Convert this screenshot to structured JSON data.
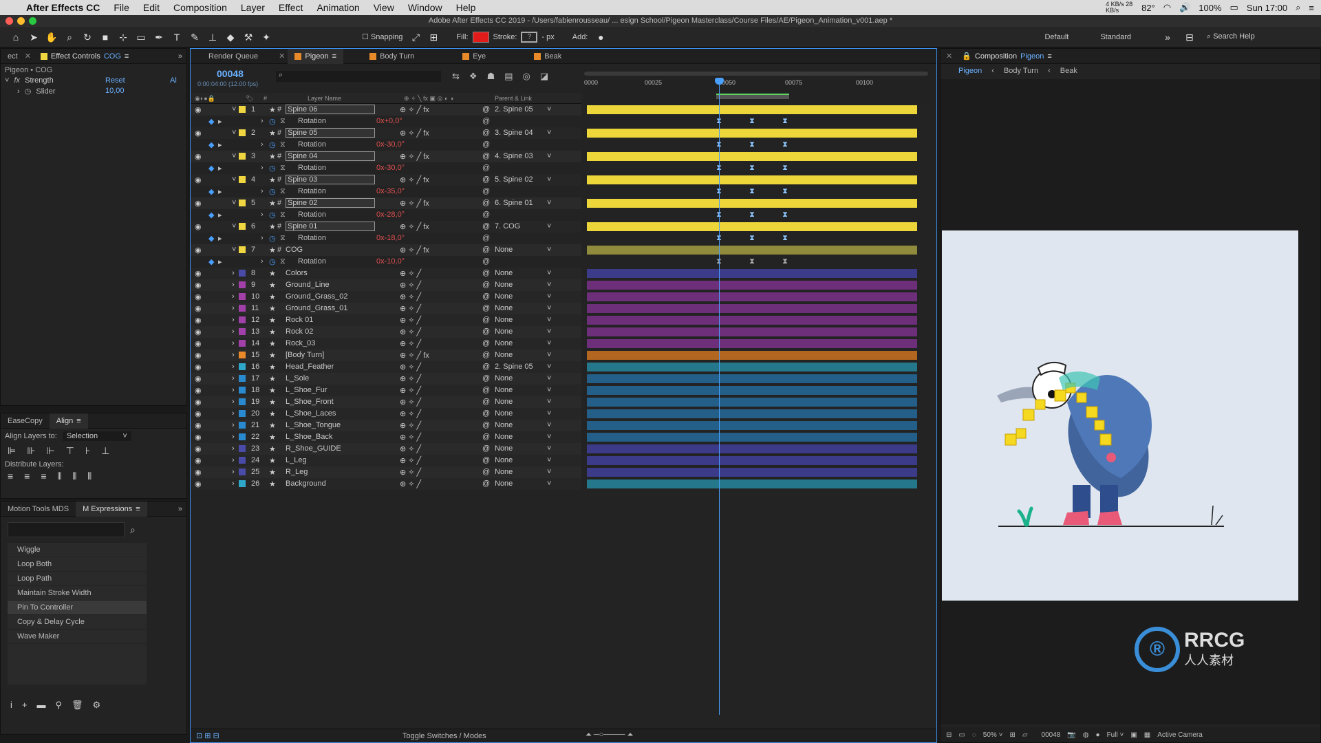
{
  "menubar": {
    "app": "After Effects CC",
    "items": [
      "File",
      "Edit",
      "Composition",
      "Layer",
      "Effect",
      "Animation",
      "View",
      "Window",
      "Help"
    ],
    "battery": "100%",
    "clock": "Sun 17:00",
    "temp": "82°",
    "net": "4 KB/s 28 KB/s"
  },
  "window_title": "Adobe After Effects CC 2019 - /Users/fabienrousseau/ ... esign School/Pigeon Masterclass/Course Files/AE/Pigeon_Animation_v001.aep *",
  "toolbar": {
    "snapping": "Snapping",
    "fill": "Fill:",
    "stroke": "Stroke:",
    "stroke_val": "?",
    "px": "- px",
    "add": "Add:",
    "workspaces": [
      "Default",
      "Standard"
    ],
    "search_placeholder": "Search Help",
    "fill_color": "#e21b1b"
  },
  "effect_controls": {
    "tab_prefix": "ect",
    "tab": "Effect Controls",
    "tab_layer": "COG",
    "breadcrumb": "Pigeon • COG",
    "effect_name": "Strength",
    "reset": "Reset",
    "about": "Al",
    "slider_label": "Slider",
    "slider_value": "10,00"
  },
  "align_panel": {
    "tabs": [
      "EaseCopy",
      "Align"
    ],
    "align_to_label": "Align Layers to:",
    "align_to_value": "Selection",
    "distribute_label": "Distribute Layers:"
  },
  "mexpressions": {
    "tabs": [
      "Motion Tools MDS",
      "M Expressions"
    ],
    "items": [
      "Wiggle",
      "Loop Both",
      "Loop Path",
      "Maintain Stroke Width",
      "Pin To Controller",
      "Copy & Delay Cycle",
      "Wave Maker"
    ]
  },
  "timeline": {
    "tabs": [
      "Render Queue",
      "Pigeon",
      "Body Turn",
      "Eye",
      "Beak"
    ],
    "timecode": "00048",
    "timecode_sub": "0:00:04:00 (12.00 fps)",
    "col_layer_name": "Layer Name",
    "col_parent": "Parent & Link",
    "col_num": "#",
    "ruler": [
      "0000",
      "00025",
      "0050",
      "00075",
      "00100"
    ],
    "playhead_frame": 48,
    "toggle_label": "Toggle Switches / Modes",
    "layers": [
      {
        "num": "1",
        "name": "Spine 06",
        "boxed": true,
        "color": "#f0d640",
        "parent": "2. Spine 05",
        "rot": "0x+0,0°",
        "bar": "#ecd63a",
        "fx": true
      },
      {
        "num": "2",
        "name": "Spine 05",
        "boxed": true,
        "color": "#f0d640",
        "parent": "3. Spine 04",
        "rot": "0x-30,0°",
        "bar": "#ecd63a",
        "fx": true
      },
      {
        "num": "3",
        "name": "Spine 04",
        "boxed": true,
        "color": "#f0d640",
        "parent": "4. Spine 03",
        "rot": "0x-30,0°",
        "bar": "#ecd63a",
        "fx": true
      },
      {
        "num": "4",
        "name": "Spine 03",
        "boxed": true,
        "color": "#f0d640",
        "parent": "5. Spine 02",
        "rot": "0x-35,0°",
        "bar": "#ecd63a",
        "fx": true
      },
      {
        "num": "5",
        "name": "Spine 02",
        "boxed": true,
        "color": "#f0d640",
        "parent": "6. Spine 01",
        "rot": "0x-28,0°",
        "bar": "#ecd63a",
        "fx": true
      },
      {
        "num": "6",
        "name": "Spine 01",
        "boxed": true,
        "color": "#f0d640",
        "parent": "7. COG",
        "rot": "0x-18,0°",
        "bar": "#ecd63a",
        "fx": true
      },
      {
        "num": "7",
        "name": "COG",
        "boxed": false,
        "color": "#f0d640",
        "parent": "None",
        "rot": "0x-10,0°",
        "bar": "#8f8a3c",
        "fx": true
      },
      {
        "num": "8",
        "name": "Colors",
        "color": "#4a4aa8",
        "parent": "None",
        "bar": "#3b3b8a"
      },
      {
        "num": "9",
        "name": "Ground_Line",
        "color": "#a040a8",
        "parent": "None",
        "bar": "#6e2f7a"
      },
      {
        "num": "10",
        "name": "Ground_Grass_02",
        "color": "#a040a8",
        "parent": "None",
        "bar": "#6e2f7a"
      },
      {
        "num": "11",
        "name": "Ground_Grass_01",
        "color": "#a040a8",
        "parent": "None",
        "bar": "#6e2f7a"
      },
      {
        "num": "12",
        "name": "Rock 01",
        "color": "#a040a8",
        "parent": "None",
        "bar": "#6e2f7a"
      },
      {
        "num": "13",
        "name": "Rock 02",
        "color": "#a040a8",
        "parent": "None",
        "bar": "#6e2f7a"
      },
      {
        "num": "14",
        "name": "Rock_03",
        "color": "#a040a8",
        "parent": "None",
        "bar": "#6e2f7a"
      },
      {
        "num": "15",
        "name": "[Body Turn]",
        "color": "#e88a2a",
        "parent": "None",
        "bar": "#b3661f",
        "fx": true
      },
      {
        "num": "16",
        "name": "Head_Feather",
        "color": "#2ea7c9",
        "parent": "2. Spine 05",
        "bar": "#25778c"
      },
      {
        "num": "17",
        "name": "L_Sole",
        "color": "#2a8ad0",
        "parent": "None",
        "bar": "#245f8a"
      },
      {
        "num": "18",
        "name": "L_Shoe_Fur",
        "color": "#2a8ad0",
        "parent": "None",
        "bar": "#245f8a"
      },
      {
        "num": "19",
        "name": "L_Shoe_Front",
        "color": "#2a8ad0",
        "parent": "None",
        "bar": "#245f8a"
      },
      {
        "num": "20",
        "name": "L_Shoe_Laces",
        "color": "#2a8ad0",
        "parent": "None",
        "bar": "#245f8a"
      },
      {
        "num": "21",
        "name": "L_Shoe_Tongue",
        "color": "#2a8ad0",
        "parent": "None",
        "bar": "#245f8a"
      },
      {
        "num": "22",
        "name": "L_Shoe_Back",
        "color": "#2a8ad0",
        "parent": "None",
        "bar": "#245f8a"
      },
      {
        "num": "23",
        "name": "R_Shoe_GUIDE",
        "color": "#4a4aa8",
        "parent": "None",
        "bar": "#3b3b8a"
      },
      {
        "num": "24",
        "name": "L_Leg",
        "color": "#4a4aa8",
        "parent": "None",
        "bar": "#3b3b8a"
      },
      {
        "num": "25",
        "name": "R_Leg",
        "color": "#4a4aa8",
        "parent": "None",
        "bar": "#3b3b8a"
      },
      {
        "num": "26",
        "name": "Background",
        "color": "#2ea7c9",
        "parent": "None",
        "bar": "#25778c"
      }
    ],
    "rotation_label": "Rotation"
  },
  "composition": {
    "tab": "Composition",
    "tab_name": "Pigeon",
    "crumbs": [
      "Pigeon",
      "Body Turn",
      "Beak"
    ],
    "zoom": "50%",
    "frame": "00048",
    "quality": "Full",
    "camera": "Active Camera",
    "bg_color": "#dfe6f0"
  },
  "watermark": {
    "text": "RRCG",
    "sub": "人人素材"
  }
}
